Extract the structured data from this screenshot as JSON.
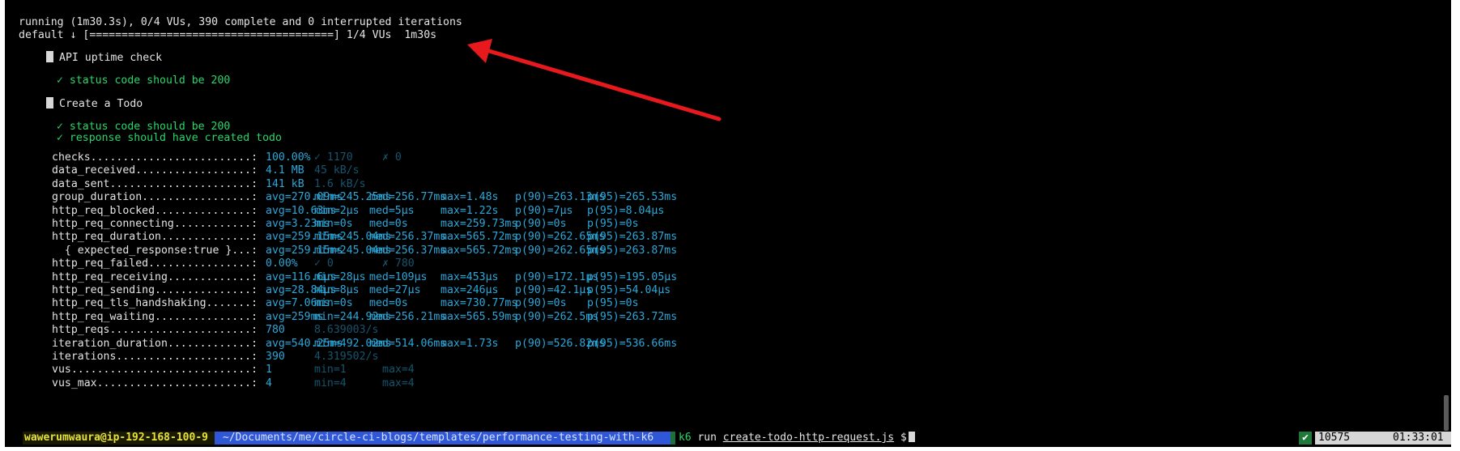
{
  "terminal": {
    "progress_status": "running (1m30.3s), 0/4 VUs, 390 complete and 0 interrupted iterations",
    "progress_bar": "default ↓ [======================================] 1/4 VUs  1m30s",
    "groups": [
      {
        "name": "API uptime check",
        "checks": [
          "✓ status code should be 200"
        ]
      },
      {
        "name": "Create a Todo",
        "checks": [
          "✓ status code should be 200",
          "✓ response should have created todo"
        ]
      }
    ],
    "metrics": [
      {
        "name": "checks.........................:",
        "c1": "100.00%",
        "c2": "✓ 1170",
        "c3": "✗ 0"
      },
      {
        "name": "data_received..................:",
        "c1": "4.1 MB",
        "c2": "45 kB/s"
      },
      {
        "name": "data_sent......................:",
        "c1": "141 kB",
        "c2": "1.6 kB/s"
      },
      {
        "name": "group_duration.................:",
        "avg": "avg=270.09ms",
        "min": "min=245.25ms",
        "med": "med=256.77ms",
        "max": "max=1.48s",
        "p90": "p(90)=263.13ms",
        "p95": "p(95)=265.53ms"
      },
      {
        "name": "http_req_blocked...............:",
        "avg": "avg=10.63ms",
        "min": "min=2µs",
        "med": "med=5µs",
        "max": "max=1.22s",
        "p90": "p(90)=7µs",
        "p95": "p(95)=8.04µs"
      },
      {
        "name": "http_req_connecting............:",
        "avg": "avg=3.23ms",
        "min": "min=0s",
        "med": "med=0s",
        "max": "max=259.73ms",
        "p90": "p(90)=0s",
        "p95": "p(95)=0s"
      },
      {
        "name": "http_req_duration..............:",
        "avg": "avg=259.15ms",
        "min": "min=245.04ms",
        "med": "med=256.37ms",
        "max": "max=565.72ms",
        "p90": "p(90)=262.65ms",
        "p95": "p(95)=263.87ms"
      },
      {
        "name": "  { expected_response:true }...:",
        "avg": "avg=259.15ms",
        "min": "min=245.04ms",
        "med": "med=256.37ms",
        "max": "max=565.72ms",
        "p90": "p(90)=262.65ms",
        "p95": "p(95)=263.87ms"
      },
      {
        "name": "http_req_failed................:",
        "c1": "0.00%",
        "c2": "✓ 0",
        "c3": "✗ 780"
      },
      {
        "name": "http_req_receiving.............:",
        "avg": "avg=116.6µs",
        "min": "min=28µs",
        "med": "med=109µs",
        "max": "max=453µs",
        "p90": "p(90)=172.1µs",
        "p95": "p(95)=195.05µs"
      },
      {
        "name": "http_req_sending...............:",
        "avg": "avg=28.84µs",
        "min": "min=8µs",
        "med": "med=27µs",
        "max": "max=246µs",
        "p90": "p(90)=42.1µs",
        "p95": "p(95)=54.04µs"
      },
      {
        "name": "http_req_tls_handshaking.......:",
        "avg": "avg=7.06ms",
        "min": "min=0s",
        "med": "med=0s",
        "max": "max=730.77ms",
        "p90": "p(90)=0s",
        "p95": "p(95)=0s"
      },
      {
        "name": "http_req_waiting...............:",
        "avg": "avg=259ms",
        "min": "min=244.92ms",
        "med": "med=256.21ms",
        "max": "max=565.59ms",
        "p90": "p(90)=262.5ms",
        "p95": "p(95)=263.72ms"
      },
      {
        "name": "http_reqs......................:",
        "c1": "780",
        "c2": "8.639003/s"
      },
      {
        "name": "iteration_duration.............:",
        "avg": "avg=540.25ms",
        "min": "min=492.02ms",
        "med": "med=514.06ms",
        "max": "max=1.73s",
        "p90": "p(90)=526.82ms",
        "p95": "p(95)=536.66ms"
      },
      {
        "name": "iterations.....................:",
        "c1": "390",
        "c2": "4.319502/s"
      },
      {
        "name": "vus............................:",
        "c1": "1",
        "c2": "min=1",
        "c3": "max=4"
      },
      {
        "name": "vus_max........................:",
        "c1": "4",
        "c2": "min=4",
        "c3": "max=4"
      }
    ]
  },
  "statusbar": {
    "user_host": "wawerumwaura@ip-192-168-100-9",
    "path": "~/Documents/me/circle-ci-blogs/templates/performance-testing-with-k6",
    "cmd_k6": "k6",
    "cmd_run": "run",
    "cmd_file": "create-todo-http-request.js",
    "prompt": "$",
    "check_mark": "✔",
    "pid": "10575",
    "clock": "01:33:01"
  },
  "colors": {
    "annotation_arrow": "#e8191d",
    "metric_value": "#2aa7d9",
    "check_pass": "#2bd66a"
  }
}
